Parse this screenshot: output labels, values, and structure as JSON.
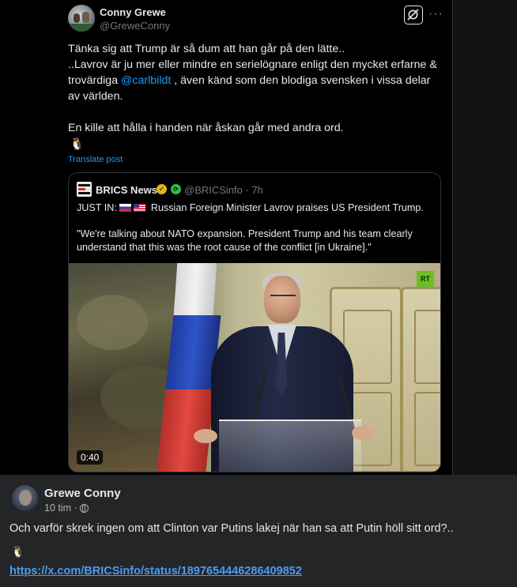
{
  "tweet": {
    "author_name": "Conny Grewe",
    "author_handle": "@GreweConny",
    "more_label": "···",
    "text_line1": "Tänka sig att Trump är så dum att han går på den lätte..",
    "text_line2_pre": "..Lavrov är ju mer eller mindre en serielögnare enligt den mycket erfarne & trovärdiga ",
    "mention": "@carlbildt",
    "text_line2_post": " , även känd som den blodiga svensken i vissa delar av världen.",
    "text_line3": "En kille att hålla i handen när åskan går med andra ord.",
    "emoji": "🐧",
    "translate_label": "Translate post"
  },
  "quoted": {
    "name": "BRICS News",
    "handle_time": "@BRICSinfo · 7h",
    "line1_prefix": "JUST IN:",
    "line1_text": "Russian Foreign Minister Lavrov praises US President Trump.",
    "quote": "\"We're talking about NATO expansion. President Trump and his team clearly understand that this was the root cause of the conflict [in Ukraine].\"",
    "video_duration": "0:40",
    "video_watermark": "RT"
  },
  "comment": {
    "author": "Grewe Conny",
    "time": "10 tim",
    "separator": "·",
    "text": "Och varför skrek ingen om att Clinton var Putins lakej när han sa att Putin höll sitt ord?..",
    "emoji": "🐧",
    "link": "https://x.com/BRICSinfo/status/1897654446286409852"
  },
  "colors": {
    "tweet_bg": "#000000",
    "fb_bg": "#242526",
    "link_blue": "#1d9bf0",
    "fb_link": "#4b9bf5"
  },
  "icons": [
    "grok-icon",
    "more-icon",
    "verified-icon",
    "affiliate-badge-icon",
    "globe-icon",
    "penguin-emoji"
  ]
}
